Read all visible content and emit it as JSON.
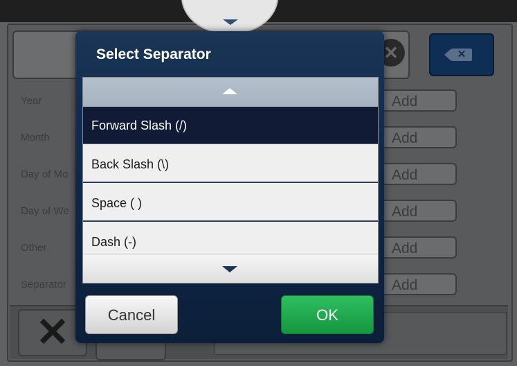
{
  "background": {
    "rows": [
      {
        "label": "Year",
        "add_label": "Add"
      },
      {
        "label": "Month",
        "add_label": "Add"
      },
      {
        "label": "Day of Mo",
        "add_label": "Add"
      },
      {
        "label": "Day of We",
        "add_label": "Add"
      },
      {
        "label": "Other",
        "add_label": "Add"
      },
      {
        "label": "Separator",
        "add_label": "Add"
      }
    ],
    "clear_icon": "✕",
    "backspace_icon": "✕",
    "close_icon": "✕"
  },
  "dialog": {
    "title": "Select Separator",
    "items": [
      {
        "label": "Forward Slash (/)",
        "selected": true
      },
      {
        "label": "Back Slash (\\)",
        "selected": false
      },
      {
        "label": "Space ( )",
        "selected": false
      },
      {
        "label": "Dash (-)",
        "selected": false
      }
    ],
    "cancel_label": "Cancel",
    "ok_label": "OK"
  },
  "colors": {
    "dialog_bg": "#11294a",
    "selected_item": "#121b35",
    "ok_button": "#1ea84c"
  }
}
